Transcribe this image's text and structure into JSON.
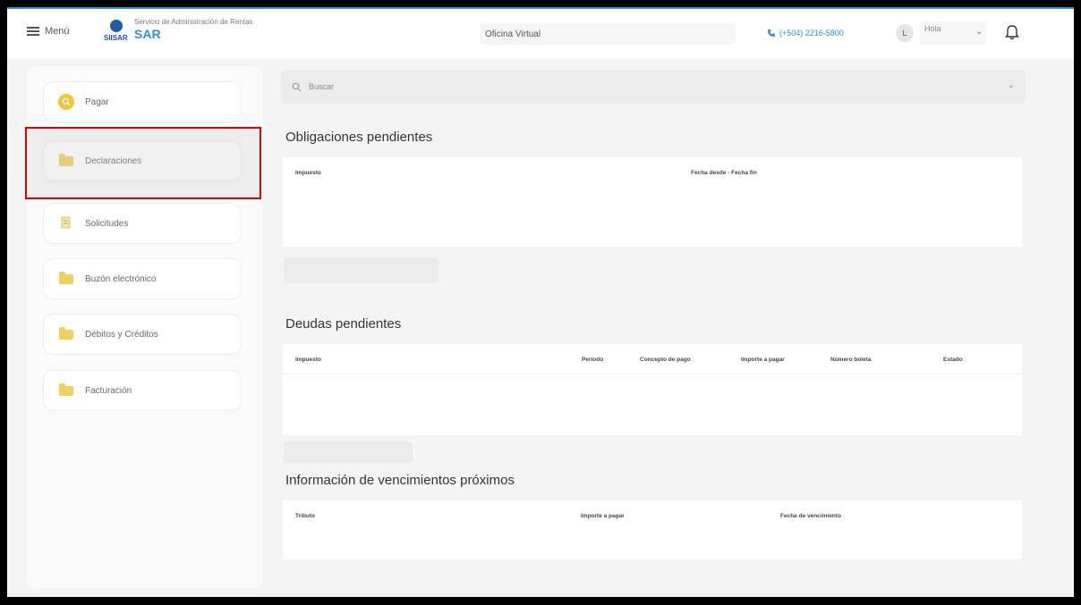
{
  "header": {
    "menu_label": "Menú",
    "brand_tag": "SIISAR",
    "brand_subtitle": "Servicio de Administración de Rentas",
    "brand_name": "SAR",
    "office_label": "Oficina Virtual",
    "phone": "(+504) 2216-5800",
    "avatar_initial": "L",
    "user_greeting": "Hola"
  },
  "sidebar": {
    "items": [
      {
        "label": "Pagar",
        "icon": "search-icon"
      },
      {
        "label": "Declaraciones",
        "icon": "folder-icon"
      },
      {
        "label": "Solicitudes",
        "icon": "document-icon"
      },
      {
        "label": "Buzón electrónico",
        "icon": "folder-icon"
      },
      {
        "label": "Débitos y Créditos",
        "icon": "folder-icon"
      },
      {
        "label": "Facturación",
        "icon": "folder-icon"
      }
    ]
  },
  "search": {
    "placeholder": "Buscar"
  },
  "sections": {
    "obligaciones": {
      "title": "Obligaciones pendientes",
      "columns": [
        "Impuesto",
        "Fecha desde - Fecha fin"
      ]
    },
    "deudas": {
      "title": "Deudas pendientes",
      "columns": [
        "Impuesto",
        "Período",
        "Concepto de pago",
        "Importe a pagar",
        "Número boleta",
        "Estado"
      ]
    },
    "vencimientos": {
      "title": "Información de vencimientos próximos",
      "columns": [
        "Tributo",
        "Importe a pagar",
        "Fecha de vencimiento"
      ]
    }
  },
  "colors": {
    "accent": "#2f8fd8",
    "highlight_border": "#e00000",
    "icon_yellow": "#f2d05b"
  }
}
